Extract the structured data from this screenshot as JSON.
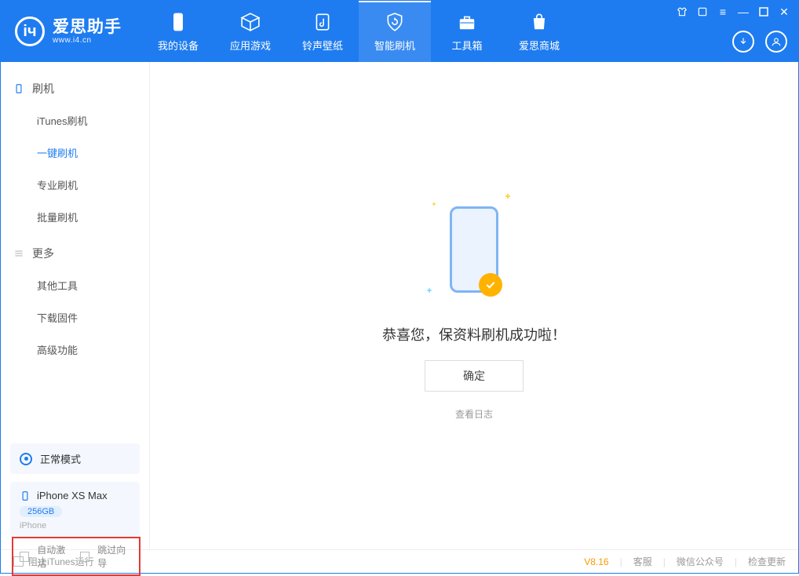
{
  "brand": {
    "title": "爱思助手",
    "subtitle": "www.i4.cn"
  },
  "nav": {
    "my_device": "我的设备",
    "apps_games": "应用游戏",
    "ringtones": "铃声壁纸",
    "smart_flash": "智能刷机",
    "toolbox": "工具箱",
    "store": "爱思商城"
  },
  "sidebar": {
    "flash": {
      "title": "刷机",
      "items": {
        "itunes": "iTunes刷机",
        "onekey": "一键刷机",
        "pro": "专业刷机",
        "batch": "批量刷机"
      }
    },
    "more": {
      "title": "更多",
      "items": {
        "other_tools": "其他工具",
        "download_fw": "下载固件",
        "advanced": "高级功能"
      }
    },
    "mode_label": "正常模式",
    "device": {
      "name": "iPhone XS Max",
      "capacity": "256GB",
      "type": "iPhone"
    },
    "options": {
      "auto_activate": "自动激活",
      "skip_guide": "跳过向导"
    }
  },
  "main": {
    "success_msg": "恭喜您，保资料刷机成功啦！",
    "ok_btn": "确定",
    "view_log": "查看日志"
  },
  "footer": {
    "block_itunes": "阻止iTunes运行",
    "version": "V8.16",
    "service": "客服",
    "wechat": "微信公众号",
    "check_update": "检查更新"
  }
}
